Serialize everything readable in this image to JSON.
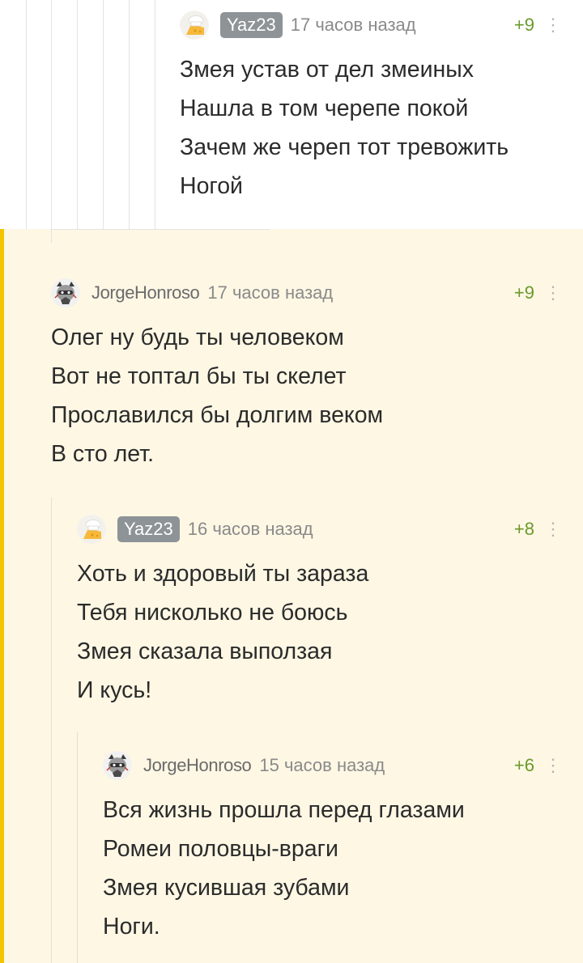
{
  "comments": [
    {
      "author": "Yaz23",
      "time": "17 часов назад",
      "rating": "+9",
      "menu": "⋮",
      "avatar": "chef-hat-cheese-avatar",
      "lines": [
        "Змея устав от дел змеиных",
        "Нашла в том черепе покой",
        "Зачем же череп тот тревожить",
        "Ногой"
      ]
    },
    {
      "author": "JorgeHonroso",
      "time": "17 часов назад",
      "rating": "+9",
      "menu": "⋮",
      "avatar": "raccoon-avatar",
      "lines": [
        "Олег ну будь ты человеком",
        "Вот не топтал бы ты скелет",
        "Прославился бы долгим веком",
        "В сто лет."
      ]
    },
    {
      "author": "Yaz23",
      "time": "16 часов назад",
      "rating": "+8",
      "menu": "⋮",
      "avatar": "chef-hat-cheese-avatar",
      "lines": [
        "Хоть и здоровый ты зараза",
        "Тебя нисколько не боюсь",
        "Змея сказала выползая",
        "И кусь!"
      ]
    },
    {
      "author": "JorgeHonroso",
      "time": "15 часов назад",
      "rating": "+6",
      "menu": "⋮",
      "avatar": "raccoon-avatar",
      "lines": [
        "Вся жизнь прошла перед глазами",
        "Ромеи половцы-враги",
        "Змея кусившая зубами",
        "Ноги."
      ]
    }
  ],
  "colors": {
    "highlight_background": "#fdf7e4",
    "accent_bar": "#f2c500",
    "rating_green": "#6a9a2b",
    "badge_gray": "#8d9396"
  }
}
